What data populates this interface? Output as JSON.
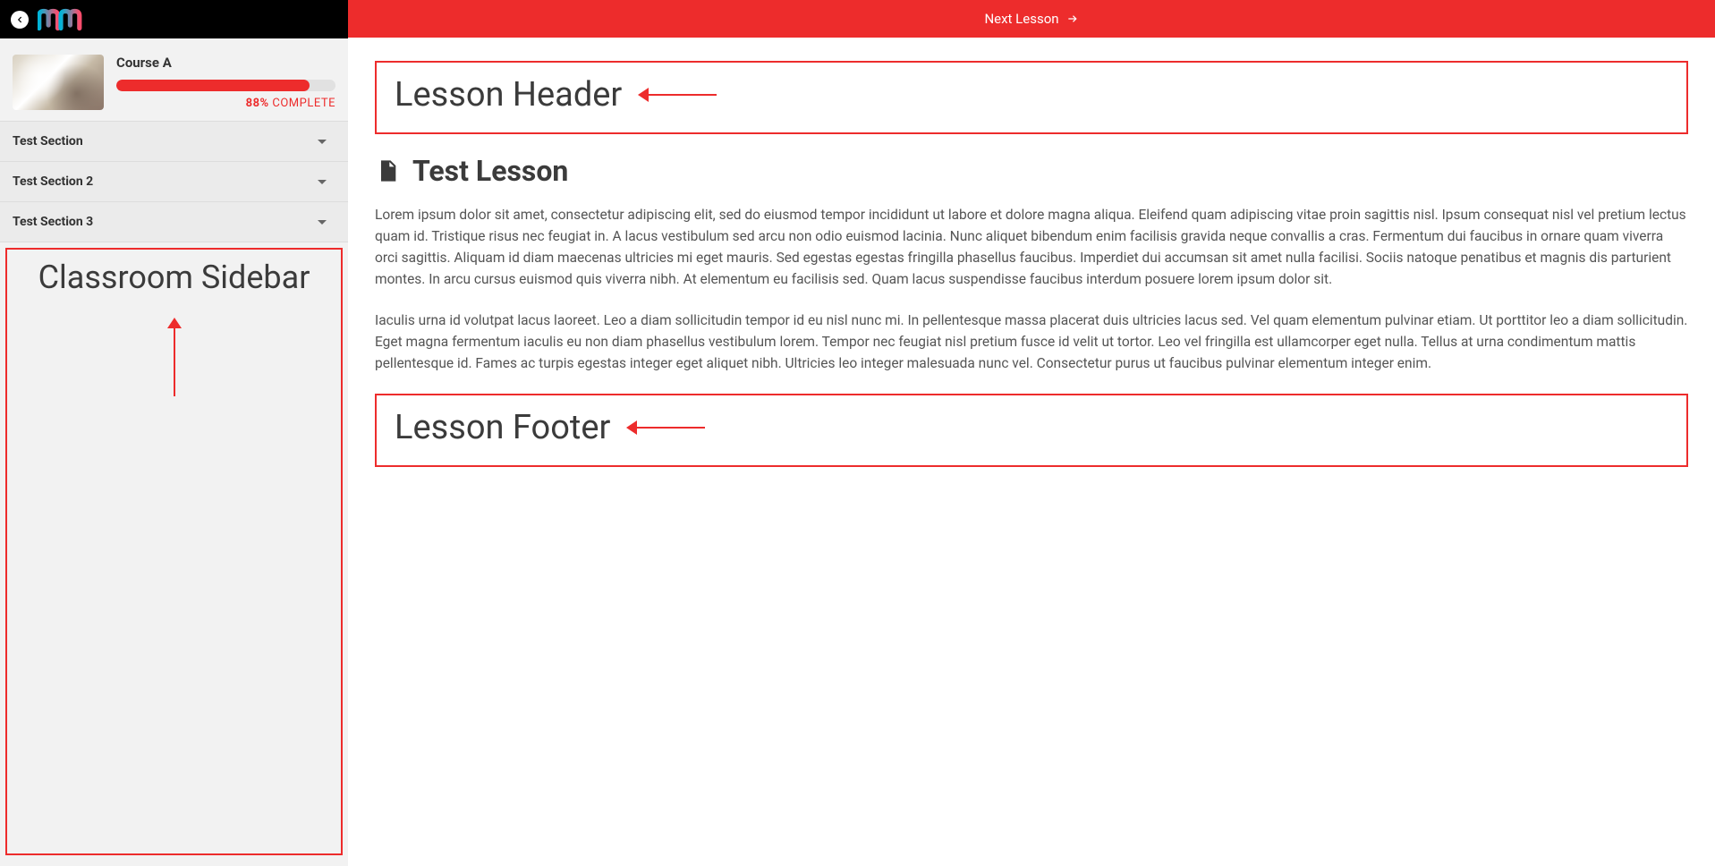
{
  "topbar": {
    "next_lesson_label": "Next Lesson"
  },
  "course": {
    "title": "Course A",
    "progress_percent": "88%",
    "progress_complete_label": "COMPLETE"
  },
  "sections": [
    {
      "label": "Test Section"
    },
    {
      "label": "Test Section 2"
    },
    {
      "label": "Test Section 3"
    }
  ],
  "sidebar_annotation": "Classroom Sidebar",
  "lesson": {
    "header_annotation": "Lesson Header",
    "title": "Test Lesson",
    "paragraph1": "Lorem ipsum dolor sit amet, consectetur adipiscing elit, sed do eiusmod tempor incididunt ut labore et dolore magna aliqua. Eleifend quam adipiscing vitae proin sagittis nisl. Ipsum consequat nisl vel pretium lectus quam id. Tristique risus nec feugiat in. A lacus vestibulum sed arcu non odio euismod lacinia. Nunc aliquet bibendum enim facilisis gravida neque convallis a cras. Fermentum dui faucibus in ornare quam viverra orci sagittis. Aliquam id diam maecenas ultricies mi eget mauris. Sed egestas egestas fringilla phasellus faucibus. Imperdiet dui accumsan sit amet nulla facilisi. Sociis natoque penatibus et magnis dis parturient montes. In arcu cursus euismod quis viverra nibh. At elementum eu facilisis sed. Quam lacus suspendisse faucibus interdum posuere lorem ipsum dolor sit.",
    "paragraph2": "Iaculis urna id volutpat lacus laoreet. Leo a diam sollicitudin tempor id eu nisl nunc mi. In pellentesque massa placerat duis ultricies lacus sed. Vel quam elementum pulvinar etiam. Ut porttitor leo a diam sollicitudin. Eget magna fermentum iaculis eu non diam phasellus vestibulum lorem. Tempor nec feugiat nisl pretium fusce id velit ut tortor. Leo vel fringilla est ullamcorper eget nulla. Tellus at urna condimentum mattis pellentesque id. Fames ac turpis egestas integer eget aliquet nibh. Ultricies leo integer malesuada nunc vel. Consectetur purus ut faucibus pulvinar elementum integer enim.",
    "footer_annotation": "Lesson Footer"
  }
}
